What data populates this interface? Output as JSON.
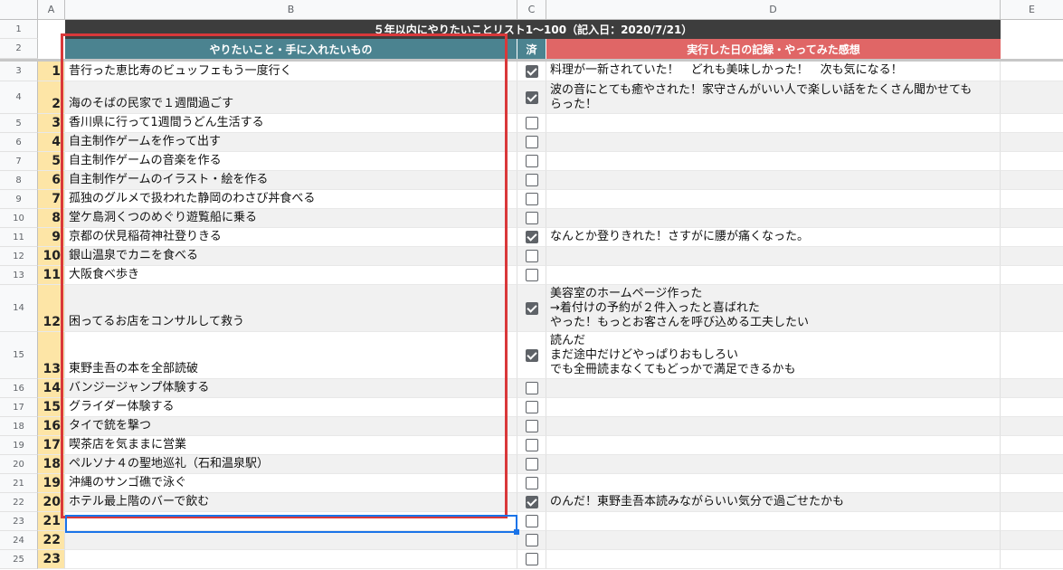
{
  "columns": [
    "A",
    "B",
    "C",
    "D",
    "E"
  ],
  "title": "５年以内にやりたいことリスト1〜100（記入日：2020/7/21）",
  "headers": {
    "want": "やりたいこと・手に入れたいもの",
    "done": "済",
    "record": "実行した日の記録・やってみた感想"
  },
  "row_numbers": [
    "1",
    "2",
    "3",
    "4",
    "5",
    "6",
    "7",
    "8",
    "9",
    "10",
    "11",
    "12",
    "13",
    "14",
    "15",
    "16",
    "17",
    "18",
    "19",
    "20",
    "21",
    "22",
    "23",
    "24",
    "25"
  ],
  "items": [
    {
      "no": "1",
      "text": "昔行った恵比寿のビュッフェもう一度行く",
      "done": true,
      "note": "料理が一新されていた！　どれも美味しかった！　次も気になる！"
    },
    {
      "no": "2",
      "text": "海のそばの民家で１週間過ごす",
      "done": true,
      "note": "波の音にとても癒やされた！家守さんがいい人で楽しい話をたくさん聞かせても\nらった！"
    },
    {
      "no": "3",
      "text": "香川県に行って1週間うどん生活する",
      "done": false,
      "note": ""
    },
    {
      "no": "4",
      "text": "自主制作ゲームを作って出す",
      "done": false,
      "note": ""
    },
    {
      "no": "5",
      "text": "自主制作ゲームの音楽を作る",
      "done": false,
      "note": ""
    },
    {
      "no": "6",
      "text": "自主制作ゲームのイラスト・絵を作る",
      "done": false,
      "note": ""
    },
    {
      "no": "7",
      "text": "孤独のグルメで扱われた静岡のわさび丼食べる",
      "done": false,
      "note": ""
    },
    {
      "no": "8",
      "text": "堂ケ島洞くつのめぐり遊覧船に乗る",
      "done": false,
      "note": ""
    },
    {
      "no": "9",
      "text": "京都の伏見稲荷神社登りきる",
      "done": true,
      "note": "なんとか登りきれた！さすがに腰が痛くなった。"
    },
    {
      "no": "10",
      "text": "銀山温泉でカニを食べる",
      "done": false,
      "note": ""
    },
    {
      "no": "11",
      "text": "大阪食べ歩き",
      "done": false,
      "note": ""
    },
    {
      "no": "12",
      "text": "困ってるお店をコンサルして救う",
      "done": true,
      "note": "美容室のホームページ作った\n→着付けの予約が２件入ったと喜ばれた\nやった！もっとお客さんを呼び込める工夫したい"
    },
    {
      "no": "13",
      "text": "東野圭吾の本を全部読破",
      "done": true,
      "note": "読んだ\nまだ途中だけどやっぱりおもしろい\nでも全冊読まなくてもどっかで満足できるかも"
    },
    {
      "no": "14",
      "text": "バンジージャンプ体験する",
      "done": false,
      "note": ""
    },
    {
      "no": "15",
      "text": "グライダー体験する",
      "done": false,
      "note": ""
    },
    {
      "no": "16",
      "text": "タイで銃を撃つ",
      "done": false,
      "note": ""
    },
    {
      "no": "17",
      "text": "喫茶店を気ままに営業",
      "done": false,
      "note": ""
    },
    {
      "no": "18",
      "text": "ペルソナ４の聖地巡礼（石和温泉駅）",
      "done": false,
      "note": ""
    },
    {
      "no": "19",
      "text": "沖縄のサンゴ礁で泳ぐ",
      "done": false,
      "note": ""
    },
    {
      "no": "20",
      "text": "ホテル最上階のバーで飲む",
      "done": true,
      "note": "のんだ！東野圭吾本読みながらいい気分で過ごせたかも"
    },
    {
      "no": "21",
      "text": "",
      "done": false,
      "note": ""
    },
    {
      "no": "22",
      "text": "",
      "done": false,
      "note": ""
    },
    {
      "no": "23",
      "text": "",
      "done": false,
      "note": ""
    }
  ]
}
